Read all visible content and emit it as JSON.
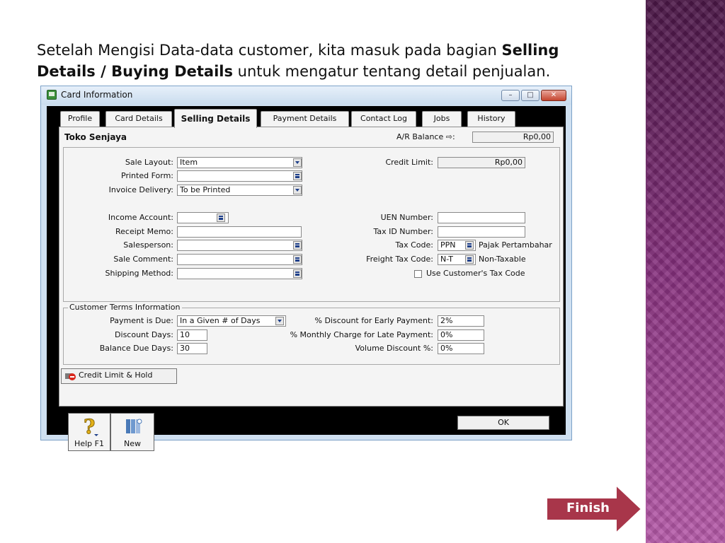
{
  "slide": {
    "intro_pre": "Setelah Mengisi Data-data customer, kita masuk pada bagian ",
    "intro_bold": "Selling Details / Buying Details",
    "intro_post": " untuk mengatur tentang detail penjualan.",
    "finish_label": "Finish",
    "accent_color": "#7a2a72"
  },
  "window": {
    "title": "Card Information",
    "minimize_icon": "minimize-icon",
    "maximize_icon": "maximize-icon",
    "close_icon": "close-icon"
  },
  "tabs": [
    {
      "label": "Profile",
      "active": false
    },
    {
      "label": "Card Details",
      "active": false
    },
    {
      "label": "Selling Details",
      "active": true
    },
    {
      "label": "Payment Details",
      "active": false
    },
    {
      "label": "Contact Log",
      "active": false
    },
    {
      "label": "Jobs",
      "active": false
    },
    {
      "label": "History",
      "active": false
    }
  ],
  "header": {
    "customer_name": "Toko Senjaya",
    "ar_balance_label": "A/R Balance ⇨:",
    "ar_balance_value": "Rp0,00"
  },
  "left_fields": {
    "sale_layout_label": "Sale Layout:",
    "sale_layout_value": "Item",
    "printed_form_label": "Printed Form:",
    "printed_form_value": "",
    "invoice_delivery_label": "Invoice Delivery:",
    "invoice_delivery_value": "To be Printed",
    "income_account_label": "Income Account:",
    "income_account_value": "",
    "receipt_memo_label": "Receipt Memo:",
    "receipt_memo_value": "",
    "salesperson_label": "Salesperson:",
    "salesperson_value": "",
    "sale_comment_label": "Sale Comment:",
    "sale_comment_value": "",
    "shipping_method_label": "Shipping Method:",
    "shipping_method_value": ""
  },
  "right_fields": {
    "credit_limit_label": "Credit Limit:",
    "credit_limit_value": "Rp0,00",
    "uen_label": "UEN Number:",
    "uen_value": "",
    "tax_id_label": "Tax ID Number:",
    "tax_id_value": "",
    "tax_code_label": "Tax Code:",
    "tax_code_value": "PPN",
    "tax_code_desc": "Pajak Pertambahar",
    "freight_tax_code_label": "Freight Tax Code:",
    "freight_tax_code_value": "N-T",
    "freight_tax_code_desc": "Non-Taxable",
    "use_customer_tax_label": "Use Customer's Tax Code"
  },
  "terms": {
    "title": "Customer Terms Information",
    "payment_due_label": "Payment is Due:",
    "payment_due_value": "In a Given # of Days",
    "discount_days_label": "Discount Days:",
    "discount_days_value": "10",
    "balance_due_days_label": "Balance Due Days:",
    "balance_due_days_value": "30",
    "early_payment_label": "% Discount for Early Payment:",
    "early_payment_value": "2%",
    "late_payment_label": "% Monthly Charge for Late Payment:",
    "late_payment_value": "0%",
    "volume_discount_label": "Volume Discount %:",
    "volume_discount_value": "0%"
  },
  "buttons": {
    "credit_limit_hold": "Credit Limit & Hold",
    "help": "Help F1",
    "new": "New",
    "ok": "OK"
  }
}
